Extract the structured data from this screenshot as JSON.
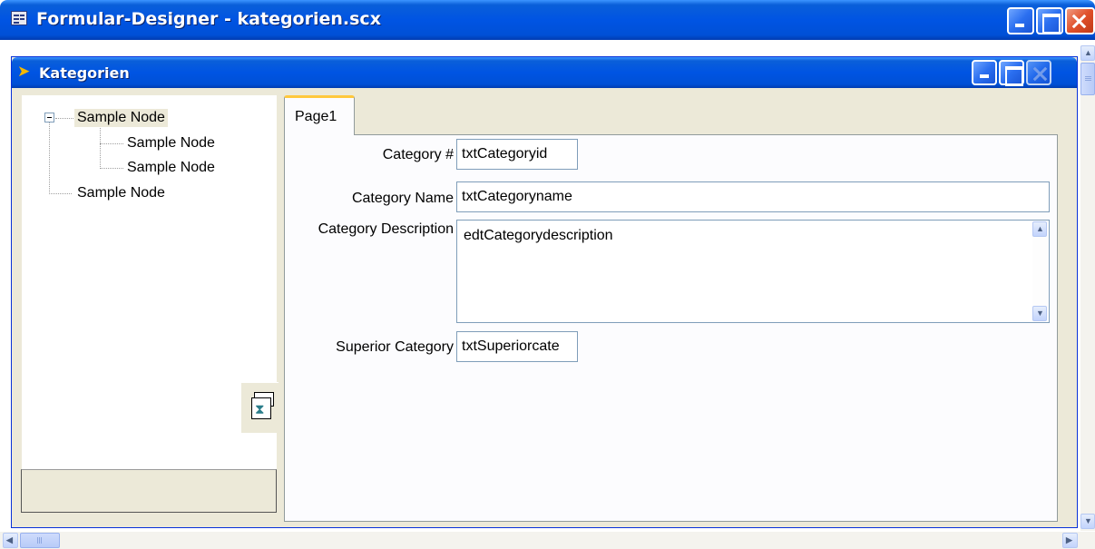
{
  "app": {
    "title": "Formular-Designer - kategorien.scx"
  },
  "form": {
    "title": "Kategorien"
  },
  "tree": {
    "nodes": [
      {
        "label": "Sample Node",
        "level": 0,
        "expanded": true,
        "selected": true
      },
      {
        "label": "Sample Node",
        "level": 1
      },
      {
        "label": "Sample Node",
        "level": 1
      },
      {
        "label": "Sample Node",
        "level": 0
      }
    ]
  },
  "pageframe": {
    "tabs": [
      {
        "label": "Page1",
        "active": true
      }
    ]
  },
  "fields": {
    "category_id": {
      "label": "Category #",
      "value": "txtCategoryid"
    },
    "category_name": {
      "label": "Category Name",
      "value": "txtCategoryname"
    },
    "category_description": {
      "label": "Category Description",
      "value": "edtCategorydescription"
    },
    "superior_category": {
      "label": "Superior Category",
      "value": "txtSuperiorcate"
    }
  },
  "icons": {
    "form_icon": "fox-icon",
    "app_icon": "form-designer-icon",
    "tool_icon": "hourglass-windows-icon"
  },
  "colors": {
    "titlebar": "#0054e3",
    "tab_highlight": "#ffc83c",
    "close_button": "#e0502a",
    "panel_bg": "#ece9d8"
  }
}
